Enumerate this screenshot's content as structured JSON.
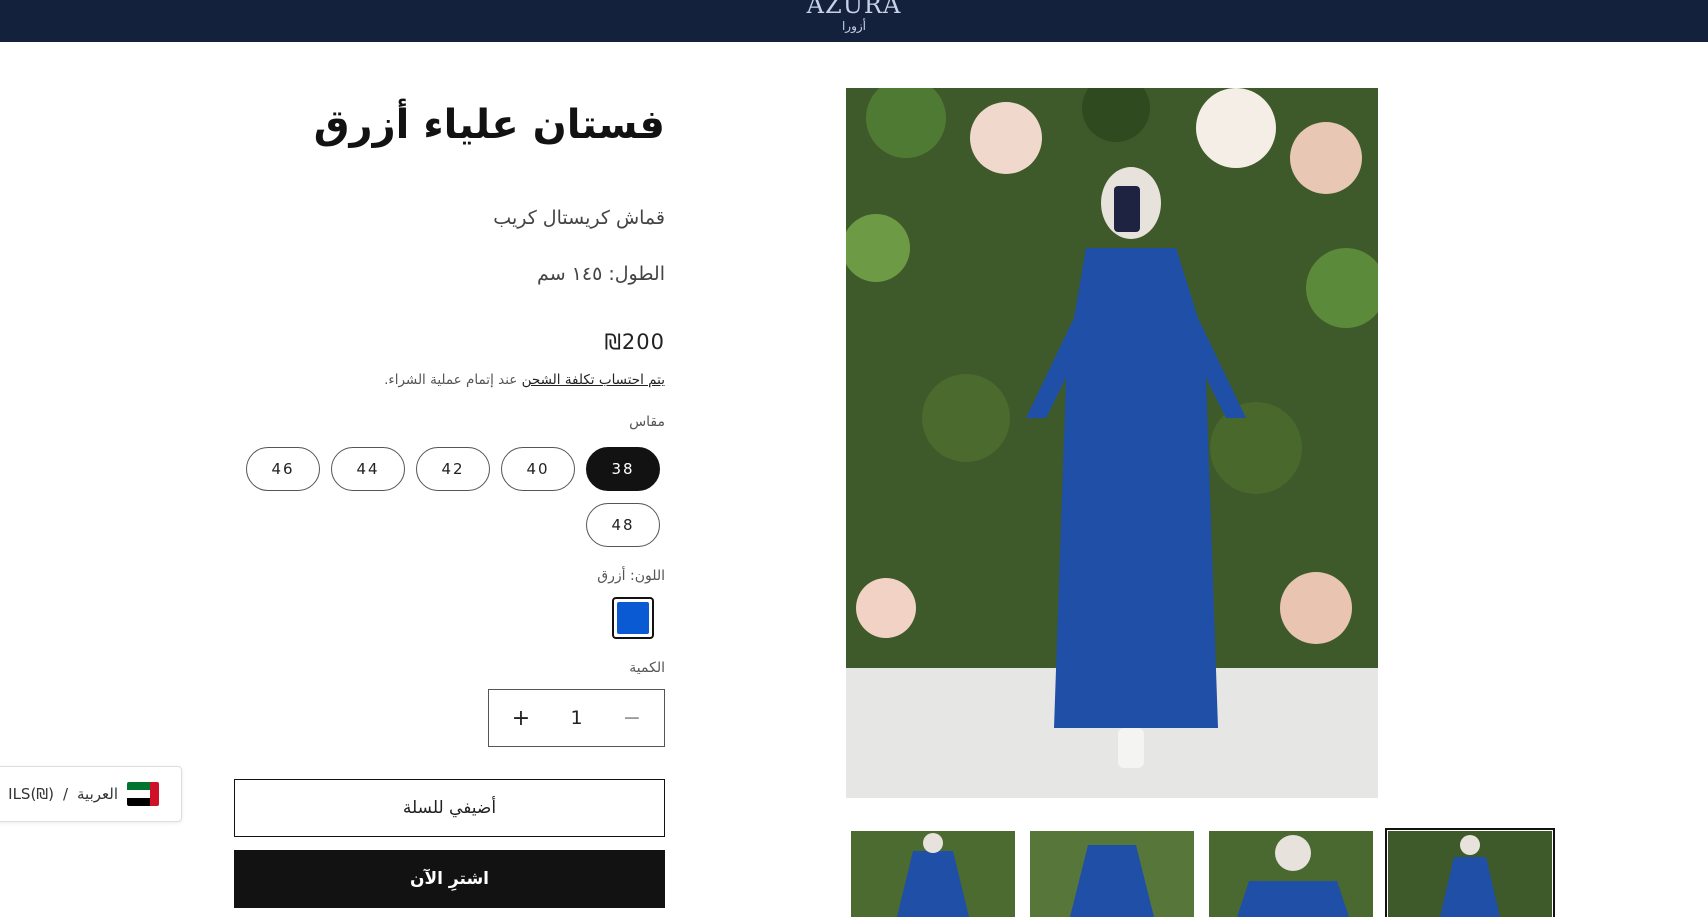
{
  "header": {
    "logo_text": "AZURA",
    "logo_subtext": "أزورا",
    "background": "#14213d"
  },
  "product": {
    "title": "فستان علياء أزرق",
    "description_line1": "قماش كريستال كريب",
    "description_line2": "الطول: ١٤٥ سم",
    "price": "₪200",
    "shipping_link": "يتم احتساب تكلفة الشحن",
    "shipping_suffix": " عند إتمام عملية الشراء."
  },
  "size": {
    "label": "مقاس",
    "selected": "38",
    "options": [
      "38",
      "40",
      "42",
      "44",
      "46",
      "48"
    ]
  },
  "color": {
    "label": "اللون: أزرق",
    "swatch": "#0a5bd3"
  },
  "quantity": {
    "label": "الكمية",
    "value": "1",
    "minus_symbol": "−",
    "plus_symbol": "+"
  },
  "buttons": {
    "add_to_cart": "أضيفي للسلة",
    "buy_now": "اشترِ الآن"
  },
  "locale": {
    "language": "العربية",
    "currency": "ILS(₪)",
    "separator": "/",
    "flag": "uae-flag-icon"
  },
  "gallery": {
    "thumbnail_count": 4,
    "selected_thumbnail": 4,
    "dress_color": "#1f4fa6"
  }
}
